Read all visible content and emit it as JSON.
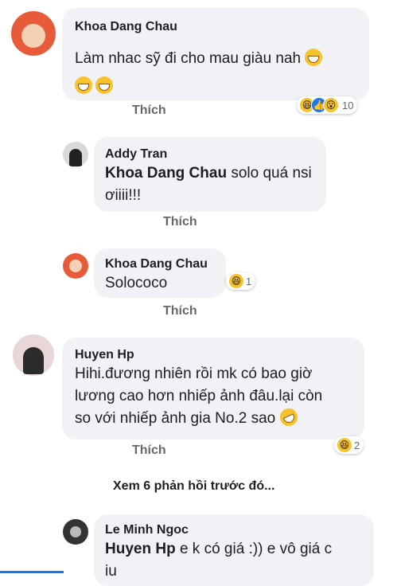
{
  "comments": [
    {
      "author": "Khoa Dang Chau",
      "text_line1": "Làm nhac sỹ đi cho mau giàu nah",
      "like_label": "Thích",
      "reaction_count": "10"
    },
    {
      "author": "Addy Tran",
      "mention": "Khoa Dang Chau",
      "text_line1": " solo quá nsi",
      "text_line2": "ơiiii!!!",
      "like_label": "Thích"
    },
    {
      "author": "Khoa Dang Chau",
      "text_line1": "Solococo",
      "like_label": "Thích",
      "reaction_count": "1"
    },
    {
      "author": "Huyen Hp",
      "text_line1": "Hihi.đương nhiên rồi mk có bao giờ",
      "text_line2": "lương cao hơn nhiếp ảnh đâu.lại còn",
      "text_line3": "so với nhiếp ảnh gia No.2 sao",
      "like_label": "Thích",
      "reaction_count": "2"
    },
    {
      "author": "Le Minh Ngoc",
      "mention": "Huyen Hp",
      "text_line1": " e k có giá :)) e vô giá c",
      "text_line2": "iu"
    }
  ],
  "view_more": "Xem 6 phản hồi trước đó...",
  "reaction_icons": [
    "haha",
    "like",
    "wow"
  ],
  "colors": {
    "bubble": "#f0f2f5",
    "accent": "#1877f2",
    "muted": "#65676b"
  }
}
